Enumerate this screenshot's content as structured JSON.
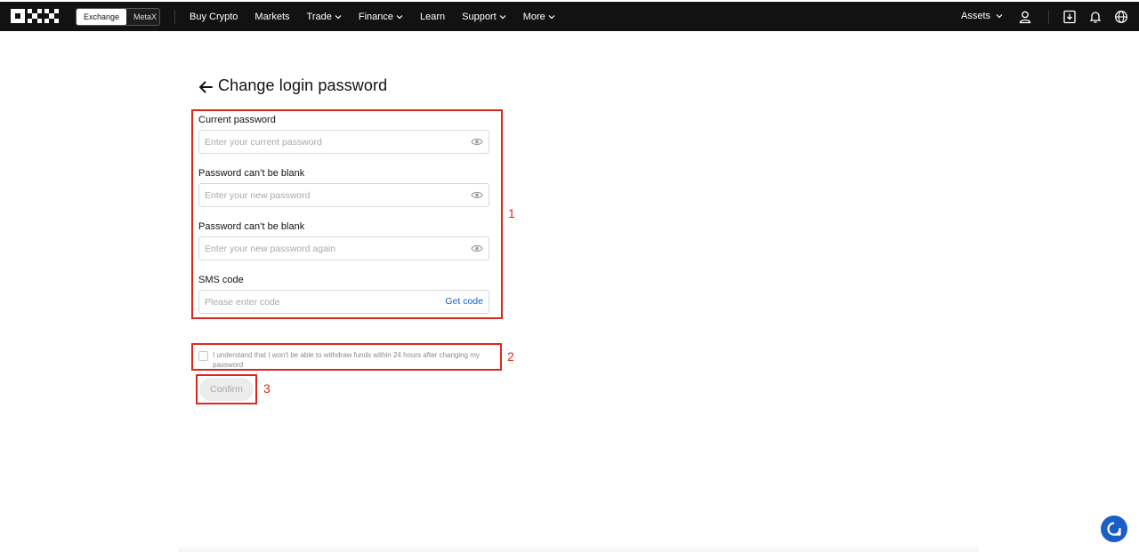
{
  "nav": {
    "logo": "OKX",
    "switcher": [
      "Exchange",
      "MetaX"
    ],
    "links": [
      {
        "label": "Buy Crypto",
        "dropdown": false
      },
      {
        "label": "Markets",
        "dropdown": false
      },
      {
        "label": "Trade",
        "dropdown": true
      },
      {
        "label": "Finance",
        "dropdown": true
      },
      {
        "label": "Learn",
        "dropdown": false
      },
      {
        "label": "Support",
        "dropdown": true
      },
      {
        "label": "More",
        "dropdown": true
      }
    ],
    "assets": "Assets",
    "icons": [
      "user-icon",
      "download-icon",
      "bell-icon",
      "globe-icon"
    ]
  },
  "page": {
    "title": "Change login password"
  },
  "form": {
    "fields": [
      {
        "label": "Current password",
        "placeholder": "Enter your current password",
        "icon": "eye-icon"
      },
      {
        "label": "Password can’t be blank",
        "placeholder": "Enter your new password",
        "icon": "eye-icon"
      },
      {
        "label": "Password can’t be blank",
        "placeholder": "Enter your new password again",
        "icon": "eye-icon"
      },
      {
        "label": "SMS code",
        "placeholder": "Please enter code",
        "action": "Get code"
      }
    ],
    "acknowledgement": "I understand that I won't be able to withdraw funds within 24 hours after changing my password",
    "confirm": "Confirm"
  },
  "annotations": [
    "1",
    "2",
    "3"
  ],
  "colors": {
    "nav_bg": "#121212",
    "annotation": "#e0261b",
    "link": "#1a5ec7"
  }
}
